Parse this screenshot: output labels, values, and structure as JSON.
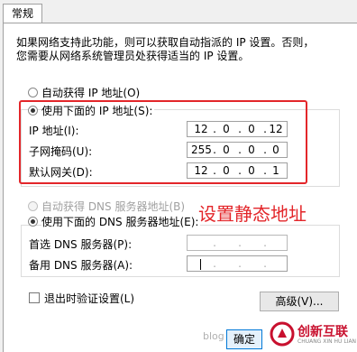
{
  "tab": {
    "label": "常规"
  },
  "intro": {
    "line1": "如果网络支持此功能，则可以获取自动指派的 IP 设置。否则，",
    "line2": "您需要从网络系统管理员处获得适当的 IP 设置。"
  },
  "ip": {
    "auto_label": "自动获得 IP 地址(O)",
    "manual_label": "使用下面的 IP 地址(S):",
    "fields": [
      {
        "label": "IP 地址(I):",
        "octets": [
          "12",
          "0",
          "0",
          "12"
        ]
      },
      {
        "label": "子网掩码(U):",
        "octets": [
          "255",
          "0",
          "0",
          "0"
        ]
      },
      {
        "label": "默认网关(D):",
        "octets": [
          "12",
          "0",
          "0",
          "1"
        ]
      }
    ]
  },
  "dns": {
    "auto_label": "自动获得 DNS 服务器地址(B)",
    "manual_label": "使用下面的 DNS 服务器地址(E):",
    "preferred_label": "首选 DNS 服务器(P):",
    "alternate_label": "备用 DNS 服务器(A):"
  },
  "annotation": {
    "text": "设置静态地址",
    "color": "#e3262a"
  },
  "validate_label": "退出时验证设置(L)",
  "advanced_button": "高级(V)...",
  "ok_button": "确定",
  "watermark": {
    "text": "创新互联",
    "sub": "CHUANG XIN HU LIAN",
    "url": "blog"
  },
  "colors": {
    "annotation_red": "#e3262a",
    "watermark_red": "#c8102e"
  }
}
